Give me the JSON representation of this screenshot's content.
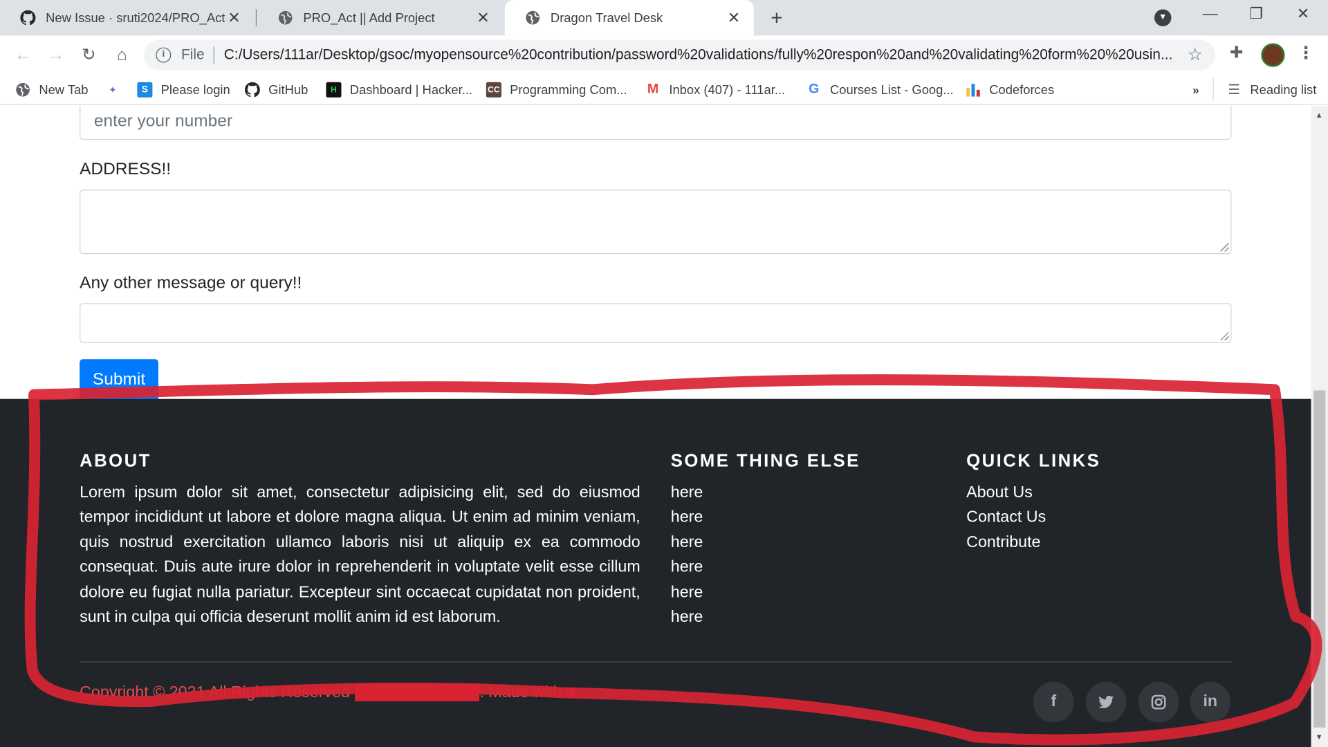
{
  "browser": {
    "tabs": [
      {
        "title": "New Issue · sruti2024/PRO_Act",
        "icon": "github-icon"
      },
      {
        "title": "PRO_Act || Add Project",
        "icon": "globe-icon"
      },
      {
        "title": "Dragon Travel Desk",
        "icon": "globe-icon",
        "active": true
      }
    ],
    "new_tab": "+",
    "window": {
      "minimize": "—",
      "restore": "❐",
      "close": "✕"
    },
    "omnibox": {
      "file_label": "File",
      "url": "C:/Users/111ar/Desktop/gsoc/myopensource%20contribution/password%20validations/fully%20respon%20and%20validating%20form%20%20usin..."
    },
    "bookmarks": [
      {
        "label": "New Tab",
        "icon": "globe-icon"
      },
      {
        "label": "",
        "icon": "app-icon"
      },
      {
        "label": "Please login",
        "icon": "s-logo-icon"
      },
      {
        "label": "GitHub",
        "icon": "github-icon"
      },
      {
        "label": "Dashboard | Hacker...",
        "icon": "hackerrank-icon"
      },
      {
        "label": "Programming Com...",
        "icon": "codechef-icon"
      },
      {
        "label": "Inbox (407) - 111ar...",
        "icon": "gmail-icon"
      },
      {
        "label": "Courses List - Goog...",
        "icon": "google-icon"
      },
      {
        "label": "Codeforces",
        "icon": "codeforces-icon"
      }
    ],
    "bookmarks_more": "»",
    "reading_list": "Reading list"
  },
  "form": {
    "number_placeholder": "enter your number",
    "address_label": "ADDRESS!!",
    "message_label": "Any other message or query!!",
    "submit_label": "Submit"
  },
  "footer": {
    "about": {
      "heading": "ABOUT",
      "text": "Lorem ipsum dolor sit amet, consectetur adipisicing elit, sed do eiusmod tempor incididunt ut labore et dolore magna aliqua. Ut enim ad minim veniam, quis nostrud exercitation ullamco laboris nisi ut aliquip ex ea commodo consequat. Duis aute irure dolor in reprehenderit in voluptate velit esse cillum dolore eu fugiat nulla pariatur. Excepteur sint occaecat cupidatat non proident, sunt in culpa qui officia deserunt mollit anim id est laborum."
    },
    "something_else": {
      "heading": "SOME THING ELSE",
      "links": [
        "here",
        "here",
        "here",
        "here",
        "here",
        "here"
      ]
    },
    "quick_links": {
      "heading": "QUICK LINKS",
      "links": [
        "About Us",
        "Contact Us",
        "Contribute"
      ]
    },
    "copyright": {
      "prefix": "Copyright © 2021 All Rights Reserved",
      "suffix": ". Made with"
    },
    "social": [
      {
        "icon": "facebook-icon",
        "glyph": "f"
      },
      {
        "icon": "twitter-icon",
        "glyph": "🐦"
      },
      {
        "icon": "instagram-icon",
        "glyph": "◎"
      },
      {
        "icon": "linkedin-icon",
        "glyph": "in"
      }
    ]
  },
  "colors": {
    "footer_bg": "#212529",
    "submit_bg": "#007bff",
    "annotation_red": "#d92332"
  }
}
